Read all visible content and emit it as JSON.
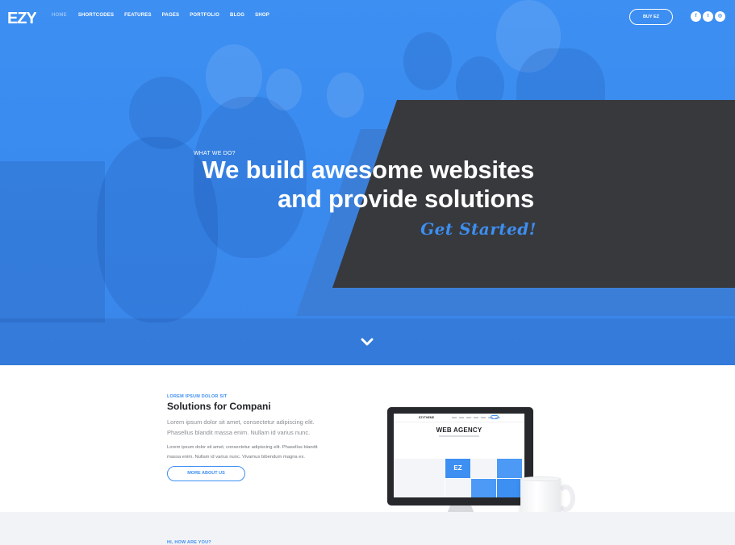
{
  "nav": {
    "logo_text": "EZY",
    "items": [
      {
        "label": "Home"
      },
      {
        "label": "Shortcodes"
      },
      {
        "label": "Features"
      },
      {
        "label": "Pages"
      },
      {
        "label": "Portfolio"
      },
      {
        "label": "Blog"
      },
      {
        "label": "Shop"
      }
    ],
    "buy_label": "BUY EZ",
    "social": [
      {
        "icon": "facebook-icon",
        "glyph": "f"
      },
      {
        "icon": "twitter-icon",
        "glyph": "t"
      },
      {
        "icon": "instagram-icon",
        "glyph": "◎"
      }
    ]
  },
  "hero": {
    "kicker": "WHAT WE DO?",
    "headline_line1": "We build awesome websites",
    "headline_line2": "and provide solutions",
    "cta": "Get Started!",
    "accent_color": "#3d8ff2",
    "panel_color": "#37393d",
    "scroll_icon": "chevron-down-icon"
  },
  "about": {
    "eyebrow": "LOREM IPSUM DOLOR SIT",
    "title": "Solutions for Compani",
    "lead": "Lorem ipsum dolor sit amet, consectetur adipiscing elit. Phasellus blandit massa enim. Nullam id varius nunc.",
    "body": "Lorem ipsum dolor sit amet, consectetur adipiscing elit. Phasellus blandit massa enim. Nullam id varius nunc. Vivamus bibendum magna ex.",
    "button": "MORE ABOUT US",
    "mockup": {
      "logo": "EZYTHEME",
      "headline": "WEB AGENCY",
      "tile_text": "EZ"
    }
  },
  "next": {
    "eyebrow": "HI, HOW ARE YOU?"
  }
}
